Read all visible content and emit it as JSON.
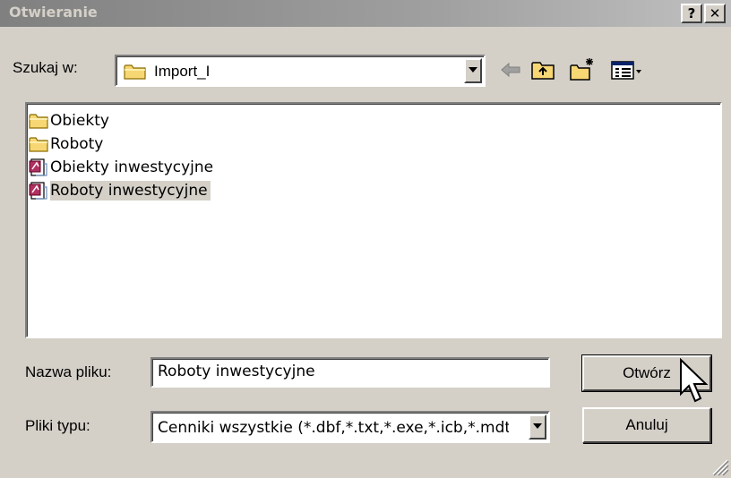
{
  "window": {
    "title": "Otwieranie",
    "help_button": "?",
    "close_button": "✕"
  },
  "lookin": {
    "label": "Szukaj w:",
    "value": "Import_I"
  },
  "files": [
    {
      "name": "Obiekty",
      "type": "folder"
    },
    {
      "name": "Roboty",
      "type": "folder"
    },
    {
      "name": "Obiekty inwestycyjne",
      "type": "document"
    },
    {
      "name": "Roboty inwestycyjne",
      "type": "document",
      "selected": true
    }
  ],
  "filename": {
    "label": "Nazwa pliku:",
    "value": "Roboty inwestycyjne"
  },
  "filetype": {
    "label": "Pliki typu:",
    "value": "Cenniki wszystkie (*.dbf,*.txt,*.exe,*.icb,*.mdt"
  },
  "buttons": {
    "open": "Otwórz",
    "cancel": "Anuluj"
  },
  "colors": {
    "face": "#d4d0c8",
    "folder": "#f7d774",
    "selection": "#d4d0c8"
  }
}
